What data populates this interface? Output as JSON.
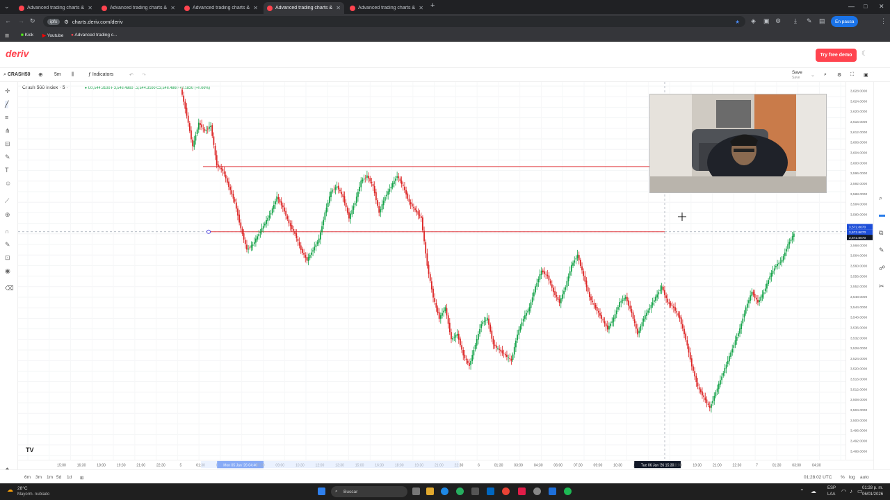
{
  "browser": {
    "tabs": [
      {
        "title": "Advanced trading charts & too",
        "active": false
      },
      {
        "title": "Advanced trading charts & too",
        "active": false
      },
      {
        "title": "Advanced trading charts & too",
        "active": false
      },
      {
        "title": "Advanced trading charts & too",
        "active": true
      },
      {
        "title": "Advanced trading charts & too",
        "active": false
      }
    ],
    "new_tab": "+",
    "url": "charts.deriv.com/deriv",
    "url_chip": "ipfs",
    "pause_label": "En pausa",
    "bookmarks": [
      "Kick",
      "Youtube",
      "Advanced trading c..."
    ]
  },
  "site": {
    "logo": "deriv",
    "try_demo_label": "Try free demo"
  },
  "toolbar": {
    "symbol": "CRASH50",
    "interval": "5m",
    "indicators_label": "Indicators",
    "save_label": "Save",
    "save_sub": "Save"
  },
  "legend": {
    "title": "Crash 500 Index · 5 ·",
    "ohlc": "O3,544.3100  H3,546.4860  L3,544.3100  C3,546.4860  +2.1820 (+0.06%)"
  },
  "chart_data": {
    "type": "candlestick",
    "symbol": "Crash 500 Index",
    "interval": "5",
    "y_ticks": [
      "3,628.0000",
      "3,624.0000",
      "3,620.0000",
      "3,616.0000",
      "3,612.0000",
      "3,608.0000",
      "3,604.0000",
      "3,600.0000",
      "3,596.0000",
      "3,592.0000",
      "3,588.0000",
      "3,584.0000",
      "3,580.0000",
      "3,576.0000",
      "3,572.0000",
      "3,568.0000",
      "3,564.0000",
      "3,560.0000",
      "3,556.0000",
      "3,552.0000",
      "3,548.0000",
      "3,544.0000",
      "3,540.0000",
      "3,536.0000",
      "3,532.0000",
      "3,528.0000",
      "3,524.0000",
      "3,520.0000",
      "3,516.0000",
      "3,512.0000",
      "3,508.0000",
      "3,504.0000",
      "3,500.0000",
      "3,496.0000",
      "3,492.0000",
      "3,488.0000"
    ],
    "ylim": [
      3488,
      3628
    ],
    "x_ticks": [
      "15:00",
      "16:30",
      "18:00",
      "19:30",
      "21:00",
      "22:30",
      "5",
      "01:30",
      "03:00",
      "Mon 05 Jan '26 04:40",
      "07:30",
      "09:00",
      "10:30",
      "12:00",
      "13:30",
      "15:00",
      "16:30",
      "18:00",
      "19:30",
      "21:00",
      "22:30",
      "6",
      "01:30",
      "03:00",
      "04:30",
      "06:00",
      "07:30",
      "09:00",
      "10:30",
      "12:00",
      "Tue 06 Jan '26 15:30",
      "18:00",
      "19:30",
      "21:00",
      "22:30",
      "7",
      "01:30",
      "03:00",
      "04:30"
    ],
    "current_price_label": "3,572.8070",
    "horizontal_lines": [
      3597.5,
      3572.8
    ],
    "price_path": [
      3627,
      3617,
      3605,
      3614,
      3611,
      3613,
      3598,
      3596,
      3590,
      3584,
      3574,
      3566,
      3568,
      3572,
      3576,
      3580,
      3586,
      3582,
      3576,
      3572,
      3566,
      3562,
      3566,
      3570,
      3580,
      3588,
      3590,
      3586,
      3578,
      3584,
      3592,
      3594,
      3590,
      3580,
      3586,
      3590,
      3594,
      3590,
      3584,
      3581,
      3578,
      3560,
      3548,
      3540,
      3544,
      3532,
      3534,
      3526,
      3522,
      3530,
      3538,
      3540,
      3530,
      3528,
      3526,
      3524,
      3534,
      3540,
      3544,
      3552,
      3558,
      3556,
      3550,
      3546,
      3552,
      3560,
      3564,
      3556,
      3548,
      3544,
      3540,
      3536,
      3540,
      3546,
      3548,
      3542,
      3534,
      3540,
      3544,
      3548,
      3552,
      3546,
      3544,
      3540,
      3532,
      3522,
      3514,
      3510,
      3506,
      3512,
      3518,
      3524,
      3530,
      3536,
      3544,
      3550,
      3546,
      3550,
      3556,
      3560,
      3562,
      3568,
      3572
    ]
  },
  "price_axis": {
    "badge_top": "3,572.8070",
    "badge_mid": "3,572.8070",
    "badge_low": "3,572.8070"
  },
  "bottom": {
    "periods": [
      "6m",
      "3m",
      "1m",
      "5d",
      "1d"
    ],
    "clock": "01:28:02 UTC",
    "pct": "%",
    "log": "log",
    "auto": "auto"
  },
  "taskbar": {
    "temp": "28°C",
    "weather": "Mayorm. nublado",
    "search_placeholder": "Buscar",
    "lang": "ESP",
    "lang2": "LAA",
    "time": "01:28 p. m.",
    "date": "06/01/2026"
  },
  "colors": {
    "up": "#16a34a",
    "down": "#dc2626",
    "brand": "#ff444f",
    "line": "#e0393e"
  }
}
